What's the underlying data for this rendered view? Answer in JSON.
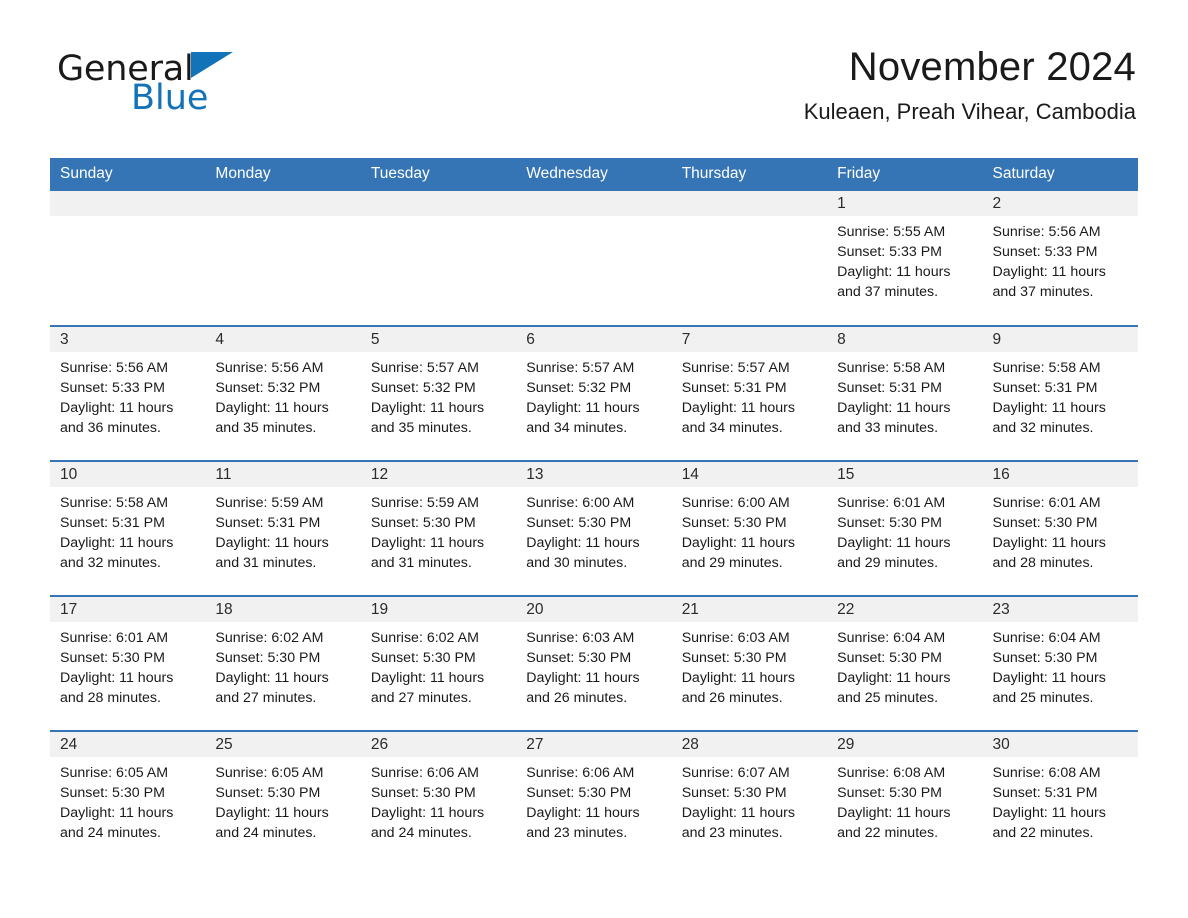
{
  "brand": {
    "name_part1": "General",
    "name_part2": "Blue",
    "accent_color": "#1273b8"
  },
  "header": {
    "month_title": "November 2024",
    "location": "Kuleaen, Preah Vihear, Cambodia"
  },
  "theme": {
    "header_row_color": "#3575b5",
    "date_band_color": "#f1f1f1",
    "row_divider_color": "#3575b5"
  },
  "calendar": {
    "weekday_headers": [
      "Sunday",
      "Monday",
      "Tuesday",
      "Wednesday",
      "Thursday",
      "Friday",
      "Saturday"
    ],
    "weeks": [
      [
        {
          "day": "",
          "empty": true
        },
        {
          "day": "",
          "empty": true
        },
        {
          "day": "",
          "empty": true
        },
        {
          "day": "",
          "empty": true
        },
        {
          "day": "",
          "empty": true
        },
        {
          "day": "1",
          "sunrise": "Sunrise: 5:55 AM",
          "sunset": "Sunset: 5:33 PM",
          "daylight": "Daylight: 11 hours and 37 minutes."
        },
        {
          "day": "2",
          "sunrise": "Sunrise: 5:56 AM",
          "sunset": "Sunset: 5:33 PM",
          "daylight": "Daylight: 11 hours and 37 minutes."
        }
      ],
      [
        {
          "day": "3",
          "sunrise": "Sunrise: 5:56 AM",
          "sunset": "Sunset: 5:33 PM",
          "daylight": "Daylight: 11 hours and 36 minutes."
        },
        {
          "day": "4",
          "sunrise": "Sunrise: 5:56 AM",
          "sunset": "Sunset: 5:32 PM",
          "daylight": "Daylight: 11 hours and 35 minutes."
        },
        {
          "day": "5",
          "sunrise": "Sunrise: 5:57 AM",
          "sunset": "Sunset: 5:32 PM",
          "daylight": "Daylight: 11 hours and 35 minutes."
        },
        {
          "day": "6",
          "sunrise": "Sunrise: 5:57 AM",
          "sunset": "Sunset: 5:32 PM",
          "daylight": "Daylight: 11 hours and 34 minutes."
        },
        {
          "day": "7",
          "sunrise": "Sunrise: 5:57 AM",
          "sunset": "Sunset: 5:31 PM",
          "daylight": "Daylight: 11 hours and 34 minutes."
        },
        {
          "day": "8",
          "sunrise": "Sunrise: 5:58 AM",
          "sunset": "Sunset: 5:31 PM",
          "daylight": "Daylight: 11 hours and 33 minutes."
        },
        {
          "day": "9",
          "sunrise": "Sunrise: 5:58 AM",
          "sunset": "Sunset: 5:31 PM",
          "daylight": "Daylight: 11 hours and 32 minutes."
        }
      ],
      [
        {
          "day": "10",
          "sunrise": "Sunrise: 5:58 AM",
          "sunset": "Sunset: 5:31 PM",
          "daylight": "Daylight: 11 hours and 32 minutes."
        },
        {
          "day": "11",
          "sunrise": "Sunrise: 5:59 AM",
          "sunset": "Sunset: 5:31 PM",
          "daylight": "Daylight: 11 hours and 31 minutes."
        },
        {
          "day": "12",
          "sunrise": "Sunrise: 5:59 AM",
          "sunset": "Sunset: 5:30 PM",
          "daylight": "Daylight: 11 hours and 31 minutes."
        },
        {
          "day": "13",
          "sunrise": "Sunrise: 6:00 AM",
          "sunset": "Sunset: 5:30 PM",
          "daylight": "Daylight: 11 hours and 30 minutes."
        },
        {
          "day": "14",
          "sunrise": "Sunrise: 6:00 AM",
          "sunset": "Sunset: 5:30 PM",
          "daylight": "Daylight: 11 hours and 29 minutes."
        },
        {
          "day": "15",
          "sunrise": "Sunrise: 6:01 AM",
          "sunset": "Sunset: 5:30 PM",
          "daylight": "Daylight: 11 hours and 29 minutes."
        },
        {
          "day": "16",
          "sunrise": "Sunrise: 6:01 AM",
          "sunset": "Sunset: 5:30 PM",
          "daylight": "Daylight: 11 hours and 28 minutes."
        }
      ],
      [
        {
          "day": "17",
          "sunrise": "Sunrise: 6:01 AM",
          "sunset": "Sunset: 5:30 PM",
          "daylight": "Daylight: 11 hours and 28 minutes."
        },
        {
          "day": "18",
          "sunrise": "Sunrise: 6:02 AM",
          "sunset": "Sunset: 5:30 PM",
          "daylight": "Daylight: 11 hours and 27 minutes."
        },
        {
          "day": "19",
          "sunrise": "Sunrise: 6:02 AM",
          "sunset": "Sunset: 5:30 PM",
          "daylight": "Daylight: 11 hours and 27 minutes."
        },
        {
          "day": "20",
          "sunrise": "Sunrise: 6:03 AM",
          "sunset": "Sunset: 5:30 PM",
          "daylight": "Daylight: 11 hours and 26 minutes."
        },
        {
          "day": "21",
          "sunrise": "Sunrise: 6:03 AM",
          "sunset": "Sunset: 5:30 PM",
          "daylight": "Daylight: 11 hours and 26 minutes."
        },
        {
          "day": "22",
          "sunrise": "Sunrise: 6:04 AM",
          "sunset": "Sunset: 5:30 PM",
          "daylight": "Daylight: 11 hours and 25 minutes."
        },
        {
          "day": "23",
          "sunrise": "Sunrise: 6:04 AM",
          "sunset": "Sunset: 5:30 PM",
          "daylight": "Daylight: 11 hours and 25 minutes."
        }
      ],
      [
        {
          "day": "24",
          "sunrise": "Sunrise: 6:05 AM",
          "sunset": "Sunset: 5:30 PM",
          "daylight": "Daylight: 11 hours and 24 minutes."
        },
        {
          "day": "25",
          "sunrise": "Sunrise: 6:05 AM",
          "sunset": "Sunset: 5:30 PM",
          "daylight": "Daylight: 11 hours and 24 minutes."
        },
        {
          "day": "26",
          "sunrise": "Sunrise: 6:06 AM",
          "sunset": "Sunset: 5:30 PM",
          "daylight": "Daylight: 11 hours and 24 minutes."
        },
        {
          "day": "27",
          "sunrise": "Sunrise: 6:06 AM",
          "sunset": "Sunset: 5:30 PM",
          "daylight": "Daylight: 11 hours and 23 minutes."
        },
        {
          "day": "28",
          "sunrise": "Sunrise: 6:07 AM",
          "sunset": "Sunset: 5:30 PM",
          "daylight": "Daylight: 11 hours and 23 minutes."
        },
        {
          "day": "29",
          "sunrise": "Sunrise: 6:08 AM",
          "sunset": "Sunset: 5:30 PM",
          "daylight": "Daylight: 11 hours and 22 minutes."
        },
        {
          "day": "30",
          "sunrise": "Sunrise: 6:08 AM",
          "sunset": "Sunset: 5:31 PM",
          "daylight": "Daylight: 11 hours and 22 minutes."
        }
      ]
    ]
  }
}
